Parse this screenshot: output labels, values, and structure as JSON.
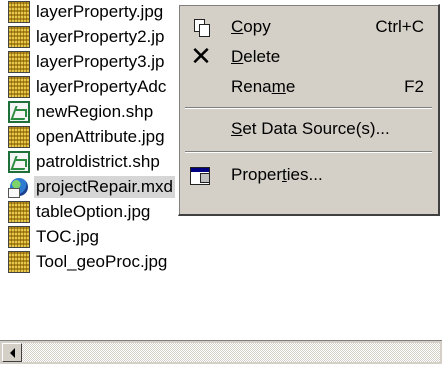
{
  "files": [
    {
      "name": "layerProperty.jpg",
      "type": "jpg",
      "icon": "jpg-file-icon"
    },
    {
      "name": "layerProperty2.jp",
      "type": "jpg",
      "icon": "jpg-file-icon"
    },
    {
      "name": "layerProperty3.jp",
      "type": "jpg",
      "icon": "jpg-file-icon"
    },
    {
      "name": "layerPropertyAdc",
      "type": "jpg",
      "icon": "jpg-file-icon"
    },
    {
      "name": "newRegion.shp",
      "type": "shp",
      "icon": "shapefile-icon"
    },
    {
      "name": "openAttribute.jpg",
      "type": "jpg",
      "icon": "jpg-file-icon"
    },
    {
      "name": "patroldistrict.shp",
      "type": "shp",
      "icon": "shapefile-icon"
    },
    {
      "name": "projectRepair.mxd",
      "type": "mxd",
      "icon": "map-document-icon",
      "selected": true
    },
    {
      "name": "tableOption.jpg",
      "type": "jpg",
      "icon": "jpg-file-icon"
    },
    {
      "name": "TOC.jpg",
      "type": "jpg",
      "icon": "jpg-file-icon"
    },
    {
      "name": "Tool_geoProc.jpg",
      "type": "jpg",
      "icon": "jpg-file-icon"
    }
  ],
  "context_menu": {
    "copy": {
      "pre": "",
      "underline": "C",
      "post": "opy",
      "shortcut": "Ctrl+C",
      "icon": "copy-icon"
    },
    "delete": {
      "pre": "",
      "underline": "D",
      "post": "elete",
      "icon": "delete-x-icon"
    },
    "rename": {
      "pre": "Rena",
      "underline": "m",
      "post": "e",
      "shortcut": "F2"
    },
    "set_data_source": {
      "pre": "",
      "underline": "S",
      "post": "et Data Source(s)..."
    },
    "properties": {
      "pre": "Proper",
      "underline": "t",
      "post": "ies...",
      "icon": "properties-icon"
    }
  },
  "colors": {
    "menu_background": "#d4d0c8",
    "selection_highlight": "#d6d6d6"
  }
}
